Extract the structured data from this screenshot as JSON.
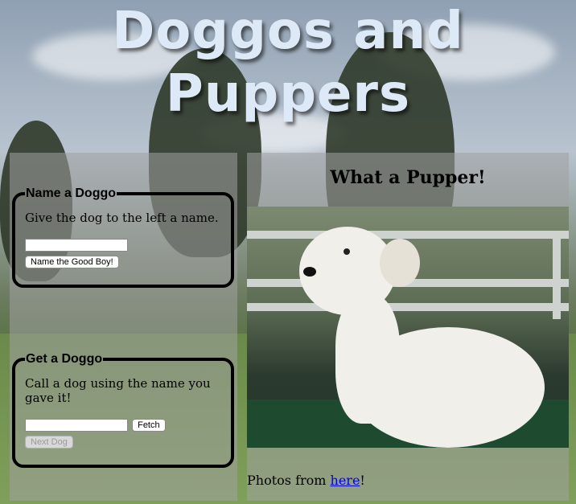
{
  "page": {
    "title": "Doggos and Puppers"
  },
  "name_section": {
    "legend": "Name a Doggo",
    "instruction": "Give the dog to the left a name.",
    "button_label": "Name the Good Boy!",
    "input_value": ""
  },
  "get_section": {
    "legend": "Get a Doggo",
    "instruction": "Call a dog using the name you gave it!",
    "fetch_label": "Fetch",
    "next_label": "Next Dog",
    "input_value": ""
  },
  "photo_panel": {
    "heading": "What a Pupper!",
    "credit_prefix": "Photos from ",
    "credit_link": "here",
    "credit_suffix": "!"
  },
  "colors": {
    "title": "#dde9f7",
    "link": "#0000ee",
    "panel_overlay": "#a0a0a0"
  }
}
